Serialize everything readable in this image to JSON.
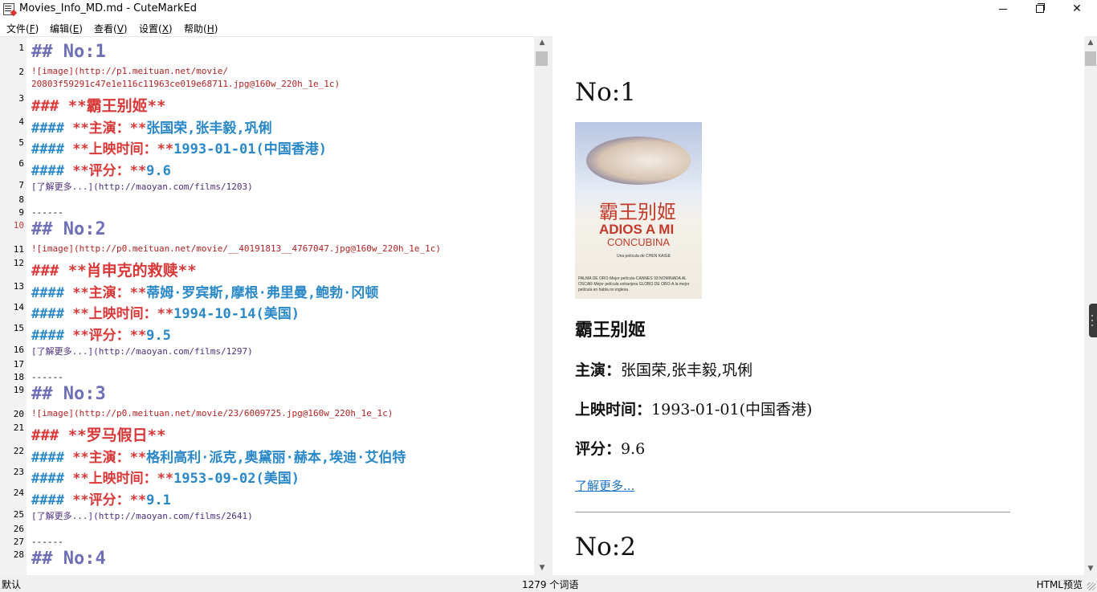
{
  "window": {
    "title": "Movies_Info_MD.md - CuteMarkEd",
    "icon": "markdown-editor-icon"
  },
  "menu": [
    {
      "label": "文件(F)",
      "text": "文件(",
      "key": "F",
      "end": ")"
    },
    {
      "label": "编辑(E)",
      "text": "编辑(",
      "key": "E",
      "end": ")"
    },
    {
      "label": "查看(V)",
      "text": "查看(",
      "key": "V",
      "end": ")"
    },
    {
      "label": "设置(X)",
      "text": "设置(",
      "key": "X",
      "end": ")"
    },
    {
      "label": "帮助(H)",
      "text": "帮助(",
      "key": "H",
      "end": ")"
    }
  ],
  "editor": {
    "current_line": 10,
    "line_numbers": [
      "1",
      "2",
      "3",
      "4",
      "5",
      "6",
      "7",
      "8",
      "9",
      "10",
      "11",
      "12",
      "13",
      "14",
      "15",
      "16",
      "17",
      "18",
      "19",
      "20",
      "21",
      "22",
      "23",
      "24",
      "25",
      "26",
      "27",
      "28"
    ],
    "lines": {
      "l1": "## No:1",
      "l2a": "![image](http://p1.meituan.net/movie/",
      "l2b": "20803f59291c47e1e116c11963ce019e68711.jpg@160w_220h_1e_1c)",
      "l3": "### **霸王别姬**",
      "l4_hash": "#### ",
      "l4_mk": "**主演：**",
      "l4_val": "张国荣,张丰毅,巩俐",
      "l5_hash": "#### ",
      "l5_mk": "**上映时间：**",
      "l5_val": "1993-01-01(中国香港)",
      "l6_hash": "#### ",
      "l6_mk": "**评分：**",
      "l6_val": "9.6",
      "l7": "[了解更多...](http://maoyan.com/films/1203)",
      "l9": "------",
      "l10": "## No:2",
      "l11": "![image](http://p0.meituan.net/movie/__40191813__4767047.jpg@160w_220h_1e_1c)",
      "l12": "### **肖申克的救赎**",
      "l13_hash": "#### ",
      "l13_mk": "**主演：**",
      "l13_val": "蒂姆·罗宾斯,摩根·弗里曼,鲍勃·冈顿",
      "l14_hash": "#### ",
      "l14_mk": "**上映时间：**",
      "l14_val": "1994-10-14(美国)",
      "l15_hash": "#### ",
      "l15_mk": "**评分：**",
      "l15_val": "9.5",
      "l16": "[了解更多...](http://maoyan.com/films/1297)",
      "l18": "------",
      "l19": "## No:3",
      "l20": "![image](http://p0.meituan.net/movie/23/6009725.jpg@160w_220h_1e_1c)",
      "l21": "### **罗马假日**",
      "l22_hash": "#### ",
      "l22_mk": "**主演：**",
      "l22_val": "格利高利·派克,奥黛丽·赫本,埃迪·艾伯特",
      "l23_hash": "#### ",
      "l23_mk": "**上映时间：**",
      "l23_val": "1953-09-02(美国)",
      "l24_hash": "#### ",
      "l24_mk": "**评分：**",
      "l24_val": "9.1",
      "l25": "[了解更多...](http://maoyan.com/films/2641)",
      "l27": "------",
      "l28": "## No:4"
    }
  },
  "preview": {
    "heading1": "No:1",
    "poster": {
      "title_cn": "霸王别姬",
      "title_en1": "ADIOS A MI",
      "title_en2": "CONCUBINA",
      "byline": "Una película de CHEN KAIGE",
      "credits": "PALMA DE ORO·Mejor película·CANNES 93 NOMINADA AL OSCAR·Mejor película extranjera GLOBO DE ORO·A la mejor película en habla no inglesa"
    },
    "movie_title": "霸王别姬",
    "actors_label": "主演：",
    "actors_value": "张国荣,张丰毅,巩俐",
    "release_label": "上映时间：",
    "release_value": "1993-01-01(中国香港)",
    "score_label": "评分：",
    "score_value": "9.6",
    "more_link": "了解更多...",
    "heading2": "No:2"
  },
  "status": {
    "left": "默认",
    "center": "1279 个词语",
    "right": "HTML预览"
  }
}
